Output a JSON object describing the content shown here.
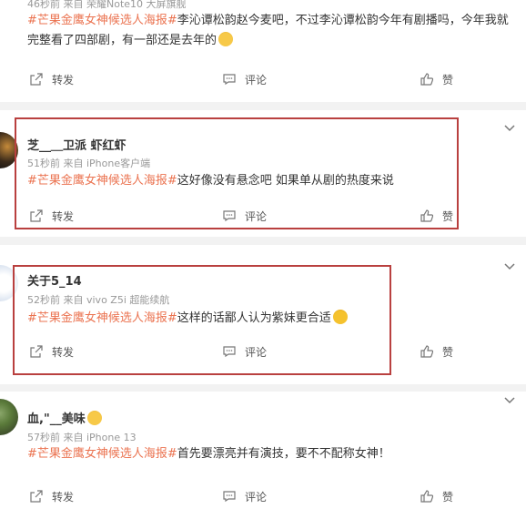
{
  "colors": {
    "tag": "#eb7350",
    "highlight_box": "#b9403f",
    "muted": "#999999"
  },
  "posts": [
    {
      "meta": "46秒前 来自 荣耀Note10 大屏旗舰",
      "tag": "#芒果金鹰女神候选人海报#",
      "text": "李沁谭松韵赵今麦吧，不过李沁谭松韵今年有剧播吗，今年我就完整看了四部剧，有一部还是去年的",
      "emoji": "laughing-crying-emoji"
    },
    {
      "username": "芝__＿卫派 虾红虾",
      "meta": "51秒前 来自 iPhone客户端",
      "tag": "#芒果金鹰女神候选人海报#",
      "text": "这好像没有悬念吧 如果单从剧的热度来说"
    },
    {
      "username": "关于5_14",
      "meta": "52秒前 来自 vivo Z5i 超能续航",
      "tag": "#芒果金鹰女神候选人海报#",
      "text": "这样的话鄙人认为紫妹更合适",
      "emoji": "grinning-emoji"
    },
    {
      "username": "血,\"__美味",
      "meta": "57秒前 来自 iPhone 13",
      "tag": "#芒果金鹰女神候选人海报#",
      "text": "首先要漂亮并有演技，要不不配称女神！"
    }
  ],
  "actions": {
    "repost": "转发",
    "comment": "评论",
    "like": "赞"
  }
}
